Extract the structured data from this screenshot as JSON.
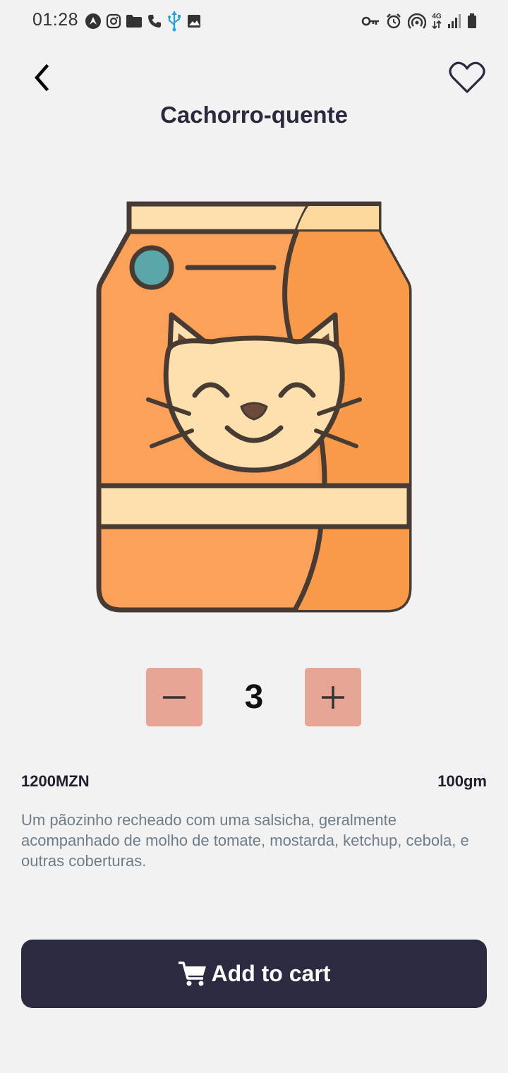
{
  "status_bar": {
    "time": "01:28",
    "left_icons": [
      "android-auto-icon",
      "instagram-icon",
      "folder-icon",
      "phone-icon",
      "usb-icon",
      "image-icon"
    ],
    "right_icons": [
      "vpn-key-icon",
      "alarm-icon",
      "hotspot-icon",
      "network-4g-icon",
      "signal-icon",
      "battery-icon"
    ],
    "network_label": "4G"
  },
  "header": {
    "title": "Cachorro-quente",
    "back_icon": "chevron-left-icon",
    "favorite_icon": "heart-outline-icon"
  },
  "product": {
    "image": "pet-food-bag-with-cat-illustration",
    "quantity": "3",
    "price": "1200MZN",
    "weight": "100gm",
    "description": "Um pãozinho recheado com uma salsicha, geralmente acompanhado de molho de tomate, mostarda, ketchup, cebola, e outras coberturas."
  },
  "cart_button": {
    "label": "Add to cart",
    "icon": "cart-icon"
  },
  "colors": {
    "background": "#f2f2f2",
    "primary_dark": "#2a2a40",
    "qty_button": "#e8a596",
    "description_text": "#6f7d89",
    "bag_orange": "#fc9d4f",
    "bag_cream": "#fde0ad",
    "bag_outline": "#473b33",
    "tag_teal": "#5aa7aa"
  }
}
